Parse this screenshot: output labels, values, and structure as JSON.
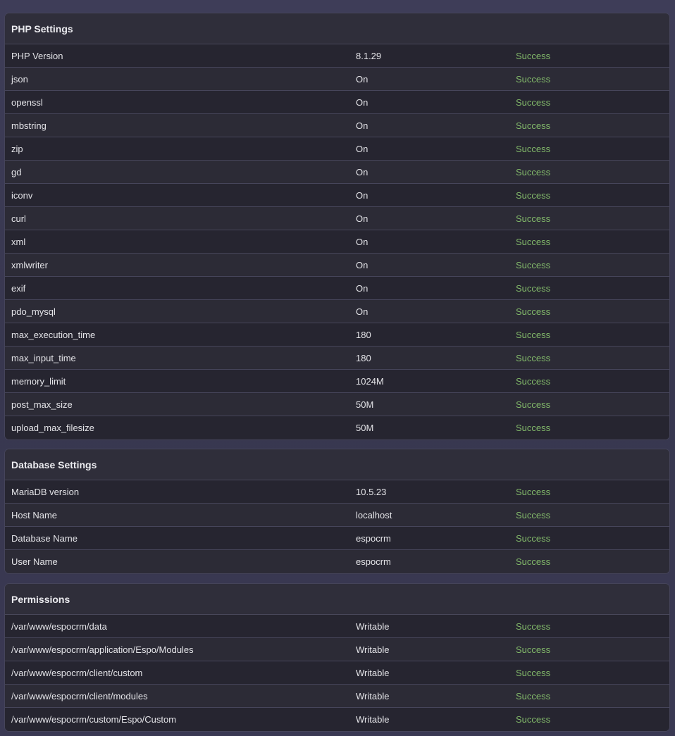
{
  "sections": [
    {
      "title": "PHP Settings",
      "rows": [
        {
          "name": "PHP Version",
          "value": "8.1.29",
          "status": "Success"
        },
        {
          "name": "json",
          "value": "On",
          "status": "Success"
        },
        {
          "name": "openssl",
          "value": "On",
          "status": "Success"
        },
        {
          "name": "mbstring",
          "value": "On",
          "status": "Success"
        },
        {
          "name": "zip",
          "value": "On",
          "status": "Success"
        },
        {
          "name": "gd",
          "value": "On",
          "status": "Success"
        },
        {
          "name": "iconv",
          "value": "On",
          "status": "Success"
        },
        {
          "name": "curl",
          "value": "On",
          "status": "Success"
        },
        {
          "name": "xml",
          "value": "On",
          "status": "Success"
        },
        {
          "name": "xmlwriter",
          "value": "On",
          "status": "Success"
        },
        {
          "name": "exif",
          "value": "On",
          "status": "Success"
        },
        {
          "name": "pdo_mysql",
          "value": "On",
          "status": "Success"
        },
        {
          "name": "max_execution_time",
          "value": "180",
          "status": "Success"
        },
        {
          "name": "max_input_time",
          "value": "180",
          "status": "Success"
        },
        {
          "name": "memory_limit",
          "value": "1024M",
          "status": "Success"
        },
        {
          "name": "post_max_size",
          "value": "50M",
          "status": "Success"
        },
        {
          "name": "upload_max_filesize",
          "value": "50M",
          "status": "Success"
        }
      ]
    },
    {
      "title": "Database Settings",
      "rows": [
        {
          "name": "MariaDB version",
          "value": "10.5.23",
          "status": "Success"
        },
        {
          "name": "Host Name",
          "value": "localhost",
          "status": "Success"
        },
        {
          "name": "Database Name",
          "value": "espocrm",
          "status": "Success"
        },
        {
          "name": "User Name",
          "value": "espocrm",
          "status": "Success"
        }
      ]
    },
    {
      "title": "Permissions",
      "rows": [
        {
          "name": "/var/www/espocrm/data",
          "value": "Writable",
          "status": "Success"
        },
        {
          "name": "/var/www/espocrm/application/Espo/Modules",
          "value": "Writable",
          "status": "Success"
        },
        {
          "name": "/var/www/espocrm/client/custom",
          "value": "Writable",
          "status": "Success"
        },
        {
          "name": "/var/www/espocrm/client/modules",
          "value": "Writable",
          "status": "Success"
        },
        {
          "name": "/var/www/espocrm/custom/Espo/Custom",
          "value": "Writable",
          "status": "Success"
        }
      ]
    }
  ],
  "colors": {
    "success": "#82b96a"
  }
}
